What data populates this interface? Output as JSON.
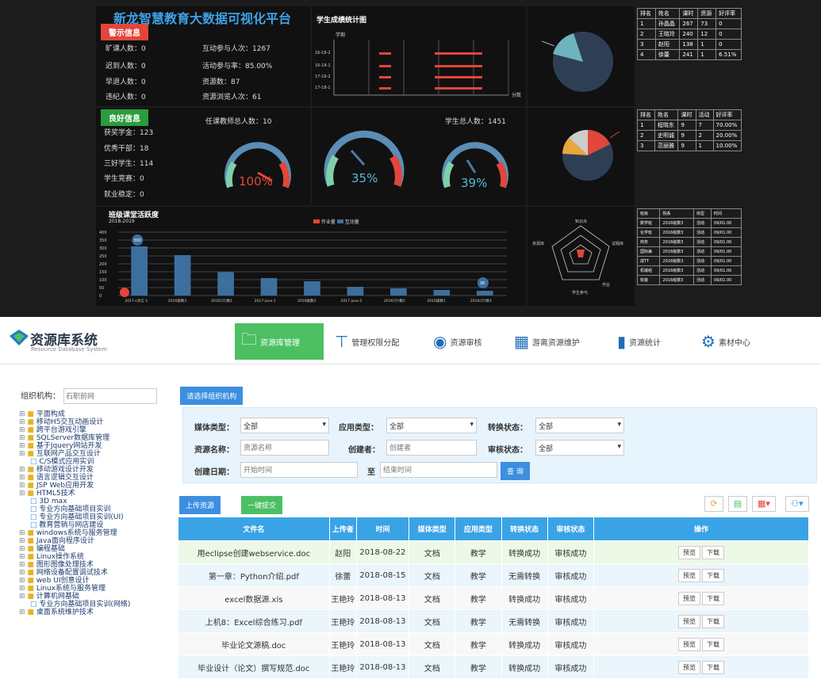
{
  "dashboard": {
    "title": "新龙智慧教育大数据可视化平台",
    "warning_tag": "警示信息",
    "warnings": [
      "旷课人数：0",
      "迟到人数：0",
      "早退人数：0",
      "违纪人数：0"
    ],
    "activity": [
      "互动参与人次：1267",
      "活动参与率：85.00%",
      "资源数：87",
      "资源浏览人次：61"
    ],
    "score_title": "学生成绩统计图",
    "score_chart": {
      "ylabel": "学期",
      "xlabel": "分数",
      "terms": [
        "16-18-2",
        "16-18-1",
        "17-18-2",
        "17-18-1"
      ],
      "ticks": [
        "0",
        "20",
        "40",
        "60",
        "80",
        "100"
      ]
    },
    "good_tag": "良好信息",
    "goods": [
      "获奖学金：123",
      "优秀干部：18",
      "三好学生：114",
      "学生竞赛：0",
      "就业稳定：0"
    ],
    "teacher_count": "任课教师总人数：10",
    "student_total": "学生总人数：1451",
    "gauges": [
      {
        "value": 100,
        "label": "100%"
      },
      {
        "value": 35,
        "label": "35%"
      },
      {
        "value": 39,
        "label": "39%"
      }
    ],
    "table1": {
      "head": [
        "排名",
        "姓名",
        "课时",
        "资源",
        "好评率"
      ],
      "rows": [
        [
          "1",
          "孙晶晶",
          "267",
          "73",
          "0"
        ],
        [
          "2",
          "王晓玲",
          "240",
          "12",
          "0"
        ],
        [
          "3",
          "赵阳",
          "138",
          "1",
          "0"
        ],
        [
          "4",
          "徐蕾",
          "241",
          "1",
          "6.51%"
        ]
      ]
    },
    "table2": {
      "head": [
        "排名",
        "姓名",
        "课时",
        "活动",
        "好评率"
      ],
      "rows": [
        [
          "1",
          "程晓东",
          "9",
          "7",
          "70.00%"
        ],
        [
          "2",
          "史明诚",
          "9",
          "2",
          "20.00%"
        ],
        [
          "3",
          "范丽雅",
          "9",
          "1",
          "10.00%"
        ]
      ]
    },
    "bar_title": "班级课堂活跃度",
    "bar_sub": "2018-2019",
    "bar_legend": [
      "作业量",
      "互动量"
    ],
    "bar_chart": {
      "type": "bar",
      "categories": [
        "2017-c语言-1",
        "2016级数3",
        "2016(计)数1",
        "2017-java-1",
        "2016级数3",
        "2017-java-2",
        "2016(计)数2",
        "2016级数1",
        "2016(计)数3"
      ],
      "values": [
        310,
        255,
        148,
        110,
        90,
        55,
        45,
        35,
        30
      ],
      "ylim": [
        0,
        400
      ],
      "ticks": [
        "0",
        "50",
        "100",
        "150",
        "200",
        "250",
        "300",
        "350",
        "400"
      ],
      "highlights": [
        "300",
        "30"
      ]
    },
    "radar_labels": [
      "知识点",
      "试题库",
      "作业",
      "学生参与",
      "资源库"
    ],
    "table3": {
      "head": [
        "班级",
        "院系",
        "体型",
        "时间"
      ],
      "rows": [
        [
          "数学班",
          "2016级数3",
          "活动",
          "09/01.00"
        ],
        [
          "化学班",
          "2016级数3",
          "活动",
          "09/01.00"
        ],
        [
          "商务",
          "2016级数3",
          "活动",
          "09/01.00"
        ],
        [
          "国际兼",
          "2016级数3",
          "活动",
          "09/01.00"
        ],
        [
          "成TT",
          "2016级数3",
          "活动",
          "09/01.00"
        ],
        [
          "机械组",
          "2016级数3",
          "活动",
          "09/01.00"
        ],
        [
          "软装",
          "2016级数3",
          "活动",
          "09/01.00"
        ]
      ]
    }
  },
  "header": {
    "app_title": "资源库系统",
    "app_sub": "Resource Database System",
    "nav": [
      "资源库管理",
      "管理权限分配",
      "资源审核",
      "游离资源维护",
      "资源统计",
      "素材中心"
    ]
  },
  "org": {
    "label": "组织机构：",
    "placeholder": "石职前网",
    "button": "请选择组织机构"
  },
  "tree": [
    "平面构成",
    "移动H5交互动画设计",
    "跨平台游戏引擎",
    "SQLServer数据库管理",
    "基于Jquery网站开发",
    "互联网产品交互设计",
    "C/S模式应用实训",
    "移动游戏设计开发",
    "语言逻辑交互设计",
    "JSP Web应用开发",
    "HTML5技术",
    "3D max",
    "专业方向基础项目实训",
    "专业方向基础项目实训(UI)",
    "教育营销与网店建设",
    "windows系统与服务管理",
    "Java面向程序设计",
    "编程基础",
    "Linux操作系统",
    "图形图像处理技术",
    "网络设备配置调试技术",
    "web UI创意设计",
    "Linux系统与服务管理",
    "计算机网基础",
    "专业方向基础项目实训(网络)",
    "桌面系统维护技术"
  ],
  "filters": {
    "media_label": "媒体类型：",
    "media_val": "全部",
    "app_label": "应用类型：",
    "app_val": "全部",
    "conv_label": "转换状态：",
    "conv_val": "全部",
    "name_label": "资源名称：",
    "name_ph": "资源名称",
    "creator_label": "创建者：",
    "creator_ph": "创建者",
    "audit_label": "审核状态：",
    "audit_val": "全部",
    "date_label": "创建日期：",
    "start_ph": "开始时间",
    "to": "至",
    "end_ph": "结束时间",
    "query": "查 询"
  },
  "actions": {
    "upload": "上传资源",
    "submit": "一键提交"
  },
  "table": {
    "head": [
      "文件名",
      "上传者",
      "时间",
      "媒体类型",
      "应用类型",
      "转换状态",
      "审核状态",
      "操作"
    ],
    "rows": [
      [
        "用eclipse创建webservice.doc",
        "赵阳",
        "2018-08-22",
        "文档",
        "教学",
        "转换成功",
        "审核成功"
      ],
      [
        "第一章：Python介绍.pdf",
        "徐蕾",
        "2018-08-15",
        "文档",
        "教学",
        "无需转换",
        "审核成功"
      ],
      [
        "excel数据源.xls",
        "王艳玲",
        "2018-08-13",
        "文档",
        "教学",
        "转换成功",
        "审核成功"
      ],
      [
        "上机8：Excel综合练习.pdf",
        "王艳玲",
        "2018-08-13",
        "文档",
        "教学",
        "无需转换",
        "审核成功"
      ],
      [
        "毕业论文源稿.doc",
        "王艳玲",
        "2018-08-13",
        "文档",
        "教学",
        "转换成功",
        "审核成功"
      ],
      [
        "毕业设计（论文）撰写规范.doc",
        "王艳玲",
        "2018-08-13",
        "文档",
        "教学",
        "转换成功",
        "审核成功"
      ]
    ],
    "op_preview": "预览",
    "op_download": "下载"
  }
}
